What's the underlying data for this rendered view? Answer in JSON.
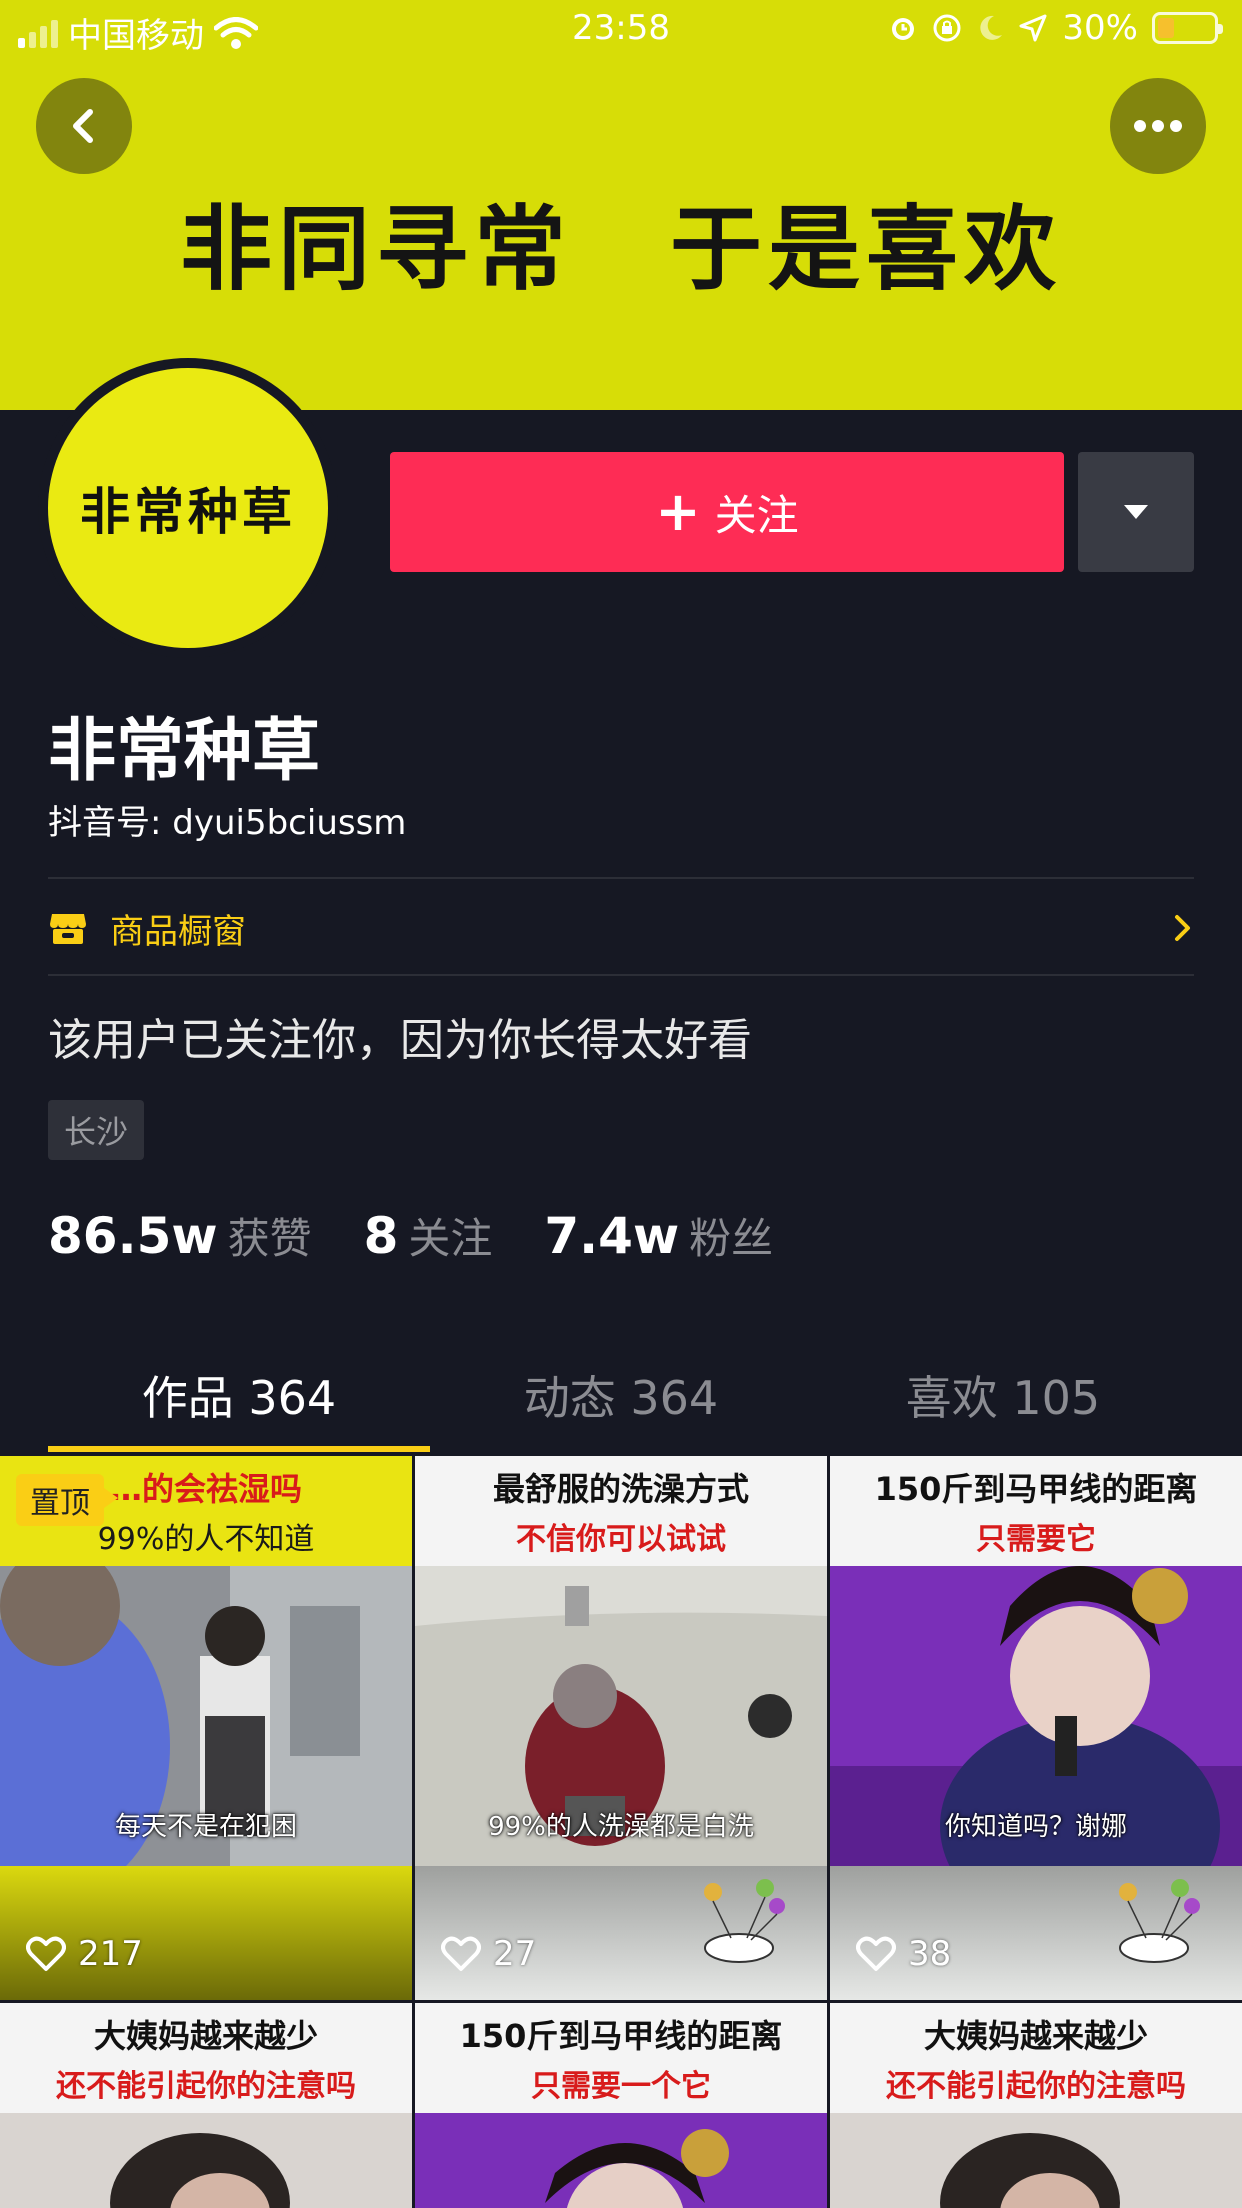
{
  "status_bar": {
    "carrier": "中国移动",
    "time": "23:58",
    "battery": "30%"
  },
  "banner": {
    "text": "非同寻常　于是喜欢"
  },
  "profile": {
    "avatar_text": "非常种草",
    "name": "非常种草",
    "douyin_id": "抖音号: dyui5bciussm",
    "follow_label": "关注",
    "shop_label": "商品橱窗",
    "bio": "该用户已关注你，因为你长得太好看",
    "location_tag": "长沙"
  },
  "stats": [
    {
      "num": "86.5w",
      "label": "获赞"
    },
    {
      "num": "8",
      "label": "关注"
    },
    {
      "num": "7.4w",
      "label": "粉丝"
    }
  ],
  "tabs": [
    {
      "label": "作品 364",
      "active": true
    },
    {
      "label": "动态 364",
      "active": false
    },
    {
      "label": "喜欢 105",
      "active": false
    }
  ],
  "videos": [
    {
      "pin": "置顶",
      "line1": "…的会祛湿吗",
      "line2": "99%的人不知道",
      "scene_caption": "每天不是在犯困",
      "likes": "217"
    },
    {
      "line1": "最舒服的洗澡方式",
      "line2": "不信你可以试试",
      "scene_caption": "99%的人洗澡都是白洗",
      "likes": "27"
    },
    {
      "line1": "150斤到马甲线的距离",
      "line2": "只需要它",
      "scene_caption": "你知道吗？谢娜",
      "likes": "38"
    },
    {
      "line1": "大姨妈越来越少",
      "line2": "还不能引起你的注意吗"
    },
    {
      "line1": "150斤到马甲线的距离",
      "line2": "只需要一个它"
    },
    {
      "line1": "大姨妈越来越少",
      "line2": "还不能引起你的注意吗"
    }
  ],
  "colors": {
    "background": "#161823",
    "banner": "#d7dd07",
    "follow": "#fe2c55",
    "accent": "#face15"
  }
}
